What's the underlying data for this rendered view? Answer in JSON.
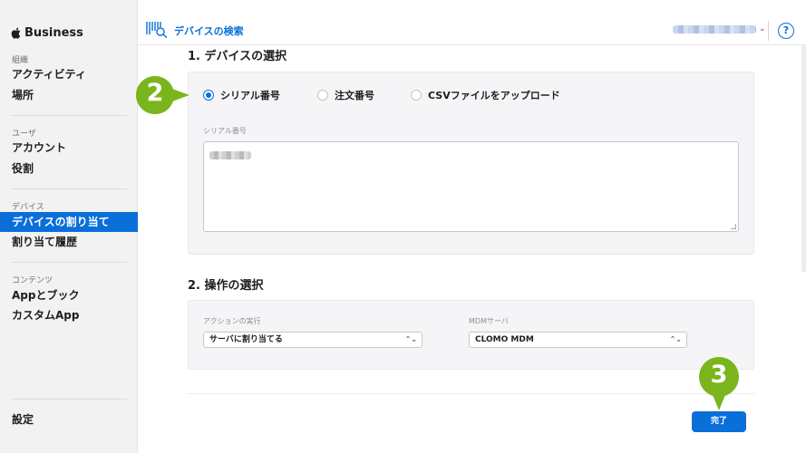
{
  "sidebar": {
    "brand": "Business",
    "sections": [
      {
        "header": "組織",
        "items": [
          "アクティビティ",
          "場所"
        ]
      },
      {
        "header": "ユーザ",
        "items": [
          "アカウント",
          "役割"
        ]
      },
      {
        "header": "デバイス",
        "items": [
          "デバイスの割り当て",
          "割り当て履歴"
        ]
      },
      {
        "header": "コンテンツ",
        "items": [
          "Appとブック",
          "カスタムApp"
        ]
      }
    ],
    "settings": "設定"
  },
  "topbar": {
    "title": "デバイスの検索",
    "help": "?"
  },
  "section1": {
    "title": "1. デバイスの選択",
    "radios": [
      "シリアル番号",
      "注文番号",
      "CSVファイルをアップロード"
    ],
    "selected": "シリアル番号",
    "serial_label": "シリアル番号"
  },
  "section2": {
    "title": "2. 操作の選択",
    "action_label": "アクションの実行",
    "action_value": "サーバに割り当てる",
    "mdm_label": "MDMサーバ",
    "mdm_value": "CLOMO MDM"
  },
  "done_button": "完了",
  "callouts": [
    "2",
    "3"
  ],
  "colors": {
    "accent": "#0a6fd9",
    "callout": "#7ab51d"
  }
}
